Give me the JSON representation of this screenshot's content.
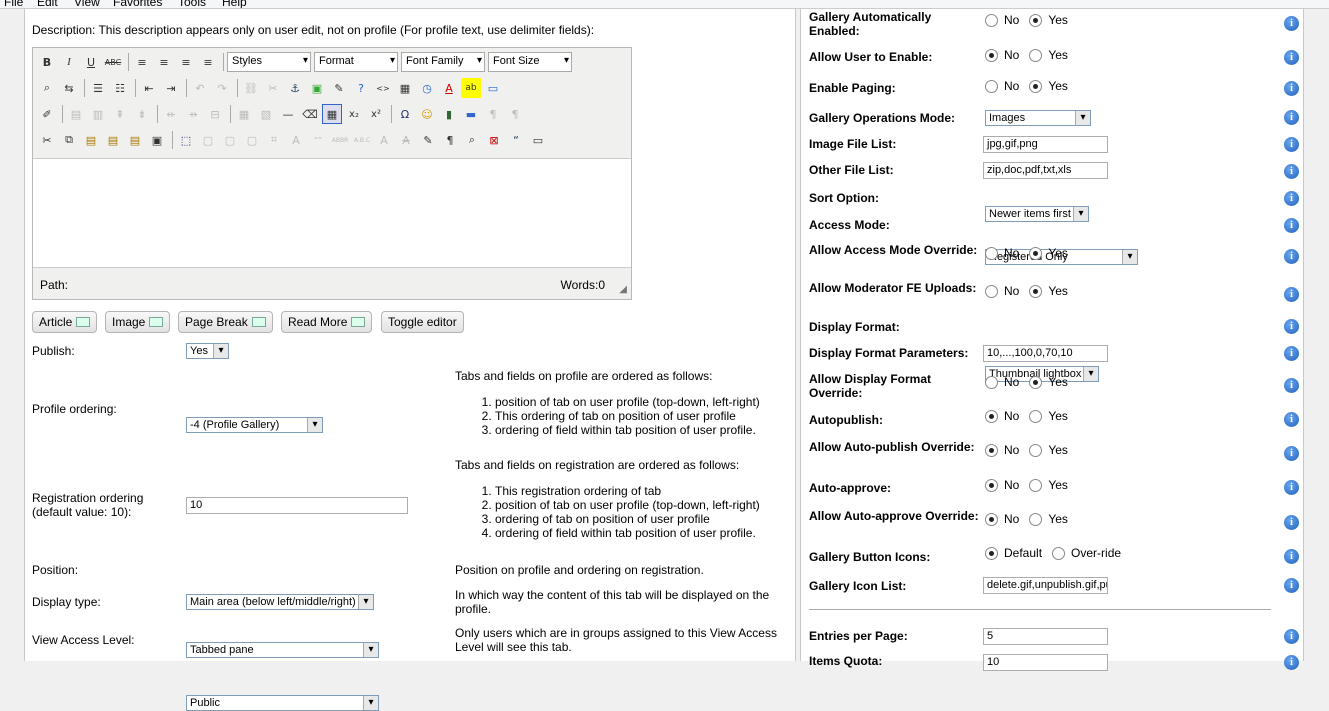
{
  "menu": [
    "File",
    "Edit",
    "View",
    "Favorites",
    "Tools",
    "Help"
  ],
  "description": "Description: This description appears only on user edit, not on profile (For profile text, use delimiter fields):",
  "editor": {
    "selects": [
      "Styles",
      "Format",
      "Font Family",
      "Font Size"
    ],
    "path_label": "Path:",
    "words_label": "Words:0"
  },
  "editor_buttons": [
    "Article",
    "Image",
    "Page Break",
    "Read More",
    "Toggle editor"
  ],
  "left_fields": {
    "publish_label": "Publish:",
    "publish_value": "Yes",
    "profile_ordering_label": "Profile ordering:",
    "profile_ordering_value": "-4 (Profile Gallery)",
    "registration_label": "Registration ordering (default value: 10):",
    "registration_value": "10",
    "position_label": "Position:",
    "position_value": "Main area (below left/middle/right)",
    "display_type_label": "Display type:",
    "display_type_value": "Tabbed pane",
    "view_access_label": "View Access Level:",
    "view_access_value": "Public"
  },
  "help": {
    "profile_intro": "Tabs and fields on profile are ordered as follows:",
    "profile_items": [
      "position of tab on user profile (top-down, left-right)",
      "This ordering of tab on position of user profile",
      "ordering of field within tab position of user profile."
    ],
    "registration_intro": "Tabs and fields on registration are ordered as follows:",
    "registration_items": [
      "This registration ordering of tab",
      "position of tab on user profile (top-down, left-right)",
      "ordering of tab on position of user profile",
      "ordering of field within tab position of user profile."
    ],
    "position_help": "Position on profile and ordering on registration.",
    "display_type_help": "In which way the content of this tab will be displayed on the profile.",
    "view_access_help": "Only users which are in groups assigned to this View Access Level will see this tab."
  },
  "right": {
    "no": "No",
    "yes": "Yes",
    "default": "Default",
    "override": "Over-ride",
    "gallery_auto_enabled": "Gallery Automatically Enabled:",
    "allow_user_enable": "Allow User to Enable:",
    "enable_paging": "Enable Paging:",
    "gallery_ops_mode": "Gallery Operations Mode:",
    "gallery_ops_mode_value": "Images",
    "image_file_list": "Image File List:",
    "image_file_list_value": "jpg,gif,png",
    "other_file_list": "Other File List:",
    "other_file_list_value": "zip,doc,pdf,txt,xls",
    "sort_option": "Sort Option:",
    "sort_option_value": "Newer items first",
    "access_mode": "Access Mode:",
    "access_mode_value": "Registered Only",
    "allow_access_override": "Allow Access Mode Override:",
    "allow_moderator_fe": "Allow Moderator FE Uploads:",
    "display_format": "Display Format:",
    "display_format_value": "Thumbnail lightbox",
    "display_format_params": "Display Format Parameters:",
    "display_format_params_value": "10,...,100,0,70,10",
    "allow_display_override": "Allow Display Format Override:",
    "autopublish": "Autopublish:",
    "allow_autopublish_override": "Allow Auto-publish Override:",
    "auto_approve": "Auto-approve:",
    "allow_autoapprove_override": "Allow Auto-approve Override:",
    "gallery_button_icons": "Gallery Button Icons:",
    "gallery_icon_list": "Gallery Icon List:",
    "gallery_icon_list_value": "delete.gif,unpublish.gif,pu",
    "entries_per_page": "Entries per Page:",
    "entries_per_page_value": "5",
    "items_quota": "Items Quota:",
    "items_quota_value": "10",
    "info_glyph": "i"
  }
}
